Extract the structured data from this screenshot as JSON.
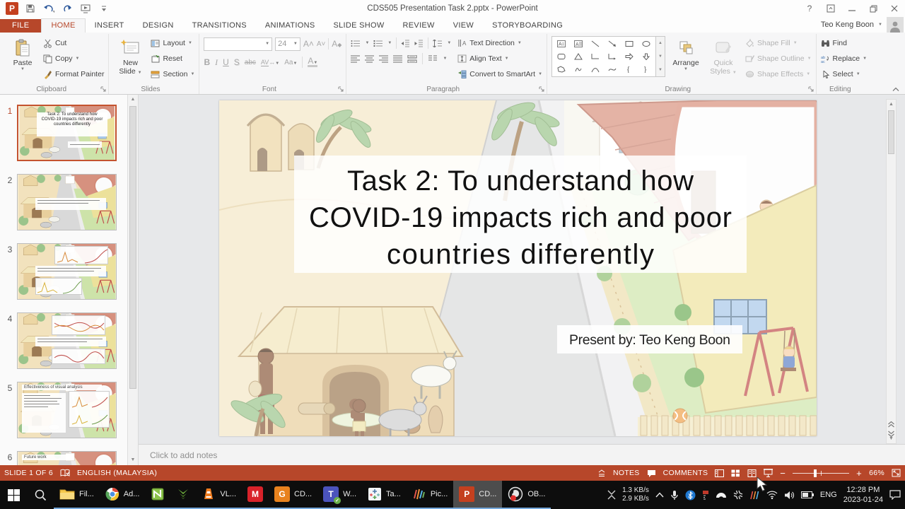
{
  "titlebar": {
    "title": "CDS505 Presentation Task 2.pptx - PowerPoint",
    "help": "?"
  },
  "tabs": [
    {
      "label": "FILE"
    },
    {
      "label": "HOME"
    },
    {
      "label": "INSERT"
    },
    {
      "label": "DESIGN"
    },
    {
      "label": "TRANSITIONS"
    },
    {
      "label": "ANIMATIONS"
    },
    {
      "label": "SLIDE SHOW"
    },
    {
      "label": "REVIEW"
    },
    {
      "label": "VIEW"
    },
    {
      "label": "STORYBOARDING"
    }
  ],
  "user": {
    "name": "Teo Keng Boon"
  },
  "ribbon": {
    "clipboard": {
      "group": "Clipboard",
      "paste": "Paste",
      "cut": "Cut",
      "copy": "Copy",
      "format_painter": "Format Painter"
    },
    "slides": {
      "group": "Slides",
      "new_slide_1": "New",
      "new_slide_2": "Slide",
      "layout": "Layout",
      "reset": "Reset",
      "section": "Section"
    },
    "font": {
      "group": "Font",
      "size": "24",
      "bold": "B",
      "italic": "I",
      "underline": "U",
      "strike": "S",
      "abc": "abc",
      "av": "AV",
      "aa": "Aa",
      "color": "A"
    },
    "paragraph": {
      "group": "Paragraph",
      "text_direction": "Text Direction",
      "align_text": "Align Text",
      "smartart": "Convert to SmartArt"
    },
    "drawing": {
      "group": "Drawing",
      "arrange": "Arrange",
      "quick_styles_1": "Quick",
      "quick_styles_2": "Styles",
      "shape_fill": "Shape Fill",
      "shape_outline": "Shape Outline",
      "shape_effects": "Shape Effects"
    },
    "editing": {
      "group": "Editing",
      "find": "Find",
      "replace": "Replace",
      "select": "Select"
    }
  },
  "thumbnails": [
    {
      "num": "1",
      "line1": "Task 2: To understand how",
      "line2": "COVID-19 impacts rich and poor",
      "line3": "countries differently"
    },
    {
      "num": "2"
    },
    {
      "num": "3"
    },
    {
      "num": "4"
    },
    {
      "num": "5",
      "title": "Effectiveness of visual analysis"
    },
    {
      "num": "6",
      "title": "Future work"
    }
  ],
  "slide": {
    "title_line1": "Task 2: To understand how",
    "title_line2": "COVID-19 impacts rich and poor",
    "title_line3": "countries differently",
    "presenter": "Present by: Teo Keng Boon"
  },
  "notes": {
    "placeholder": "Click to add notes"
  },
  "statusbar": {
    "slide_info": "SLIDE 1 OF 6",
    "language": "ENGLISH (MALAYSIA)",
    "notes": "NOTES",
    "comments": "COMMENTS",
    "zoom_level": "66%"
  },
  "taskbar": {
    "labels": {
      "file_explorer": "Fil...",
      "chrome": "Ad...",
      "vlc": "VL...",
      "pdf_app": "CD...",
      "teams": "W...",
      "tableau": "Ta...",
      "pic_app": "Pic...",
      "powerpoint": "CD...",
      "obs": "OB..."
    },
    "tray": {
      "net_up": "1.3 KB/s",
      "net_down": "2.9 KB/s",
      "language": "ENG",
      "time": "12:28 PM",
      "date": "2023-01-24"
    }
  }
}
